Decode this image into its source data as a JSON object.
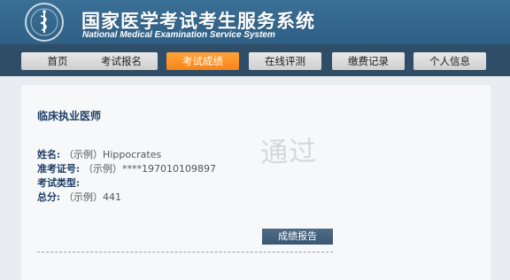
{
  "header": {
    "title_cn": "国家医学考试考生服务系统",
    "title_en": "National Medical Examination Service System",
    "logo_icon": "medical-emblem-icon"
  },
  "nav": {
    "items": [
      {
        "label": "首页",
        "active": false
      },
      {
        "label": "考试报名",
        "active": false
      },
      {
        "label": "考试成绩",
        "active": true
      },
      {
        "label": "在线评测",
        "active": false
      },
      {
        "label": "缴费记录",
        "active": false
      },
      {
        "label": "个人信息",
        "active": false
      }
    ]
  },
  "result": {
    "exam_name": "临床执业医师",
    "fields": [
      {
        "label": "姓名:",
        "value": "（示例）Hippocrates"
      },
      {
        "label": "准考证号:",
        "value": "（示例）****197010109897"
      },
      {
        "label": "考试类型:",
        "value": ""
      },
      {
        "label": "总分:",
        "value": "（示例）441"
      }
    ],
    "stamp": "通过",
    "report_button": "成绩报告"
  },
  "colors": {
    "header_bg": "#2f5f85",
    "nav_bg": "#2f4d66",
    "active_tab": "#f7851a",
    "label_text": "#1e3f66",
    "button_bg": "#3a5673"
  }
}
